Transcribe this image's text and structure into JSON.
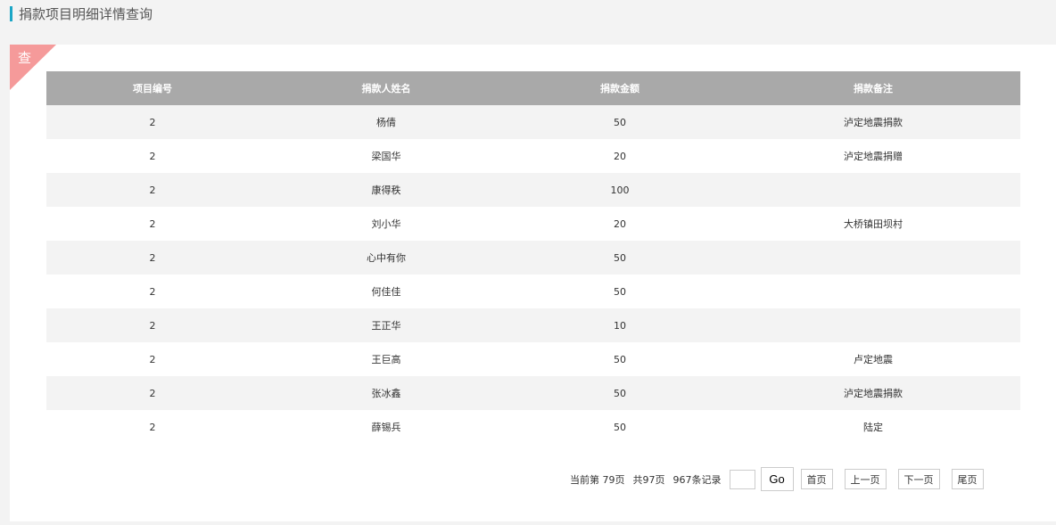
{
  "header": {
    "title": "捐款项目明细详情查询"
  },
  "panel": {
    "corner_label": "查"
  },
  "table": {
    "columns": [
      "项目编号",
      "捐款人姓名",
      "捐款金额",
      "捐款备注"
    ],
    "rows": [
      [
        "2",
        "杨倩",
        "50",
        "泸定地震捐款"
      ],
      [
        "2",
        "梁国华",
        "20",
        "泸定地震捐赠"
      ],
      [
        "2",
        "康得秩",
        "100",
        ""
      ],
      [
        "2",
        "刘小华",
        "20",
        "大桥镇田坝村"
      ],
      [
        "2",
        "心中有你",
        "50",
        ""
      ],
      [
        "2",
        "何佳佳",
        "50",
        ""
      ],
      [
        "2",
        "王正华",
        "10",
        ""
      ],
      [
        "2",
        "王巨高",
        "50",
        "卢定地震"
      ],
      [
        "2",
        "张冰鑫",
        "50",
        "泸定地震捐款"
      ],
      [
        "2",
        "薛锡兵",
        "50",
        "陆定"
      ]
    ]
  },
  "pager": {
    "current_page": "当前第 79页",
    "total_pages": "共97页",
    "total_records": "967条记录",
    "page_input_value": "",
    "go_label": "Go",
    "first_label": "首页",
    "prev_label": "上一页",
    "next_label": "下一页",
    "last_label": "尾页"
  },
  "colors": {
    "accent": "#1ba6c6",
    "corner": "#f59a9a",
    "table_header_bg": "#a9a9a9",
    "row_alt_bg": "#f3f3f3"
  }
}
